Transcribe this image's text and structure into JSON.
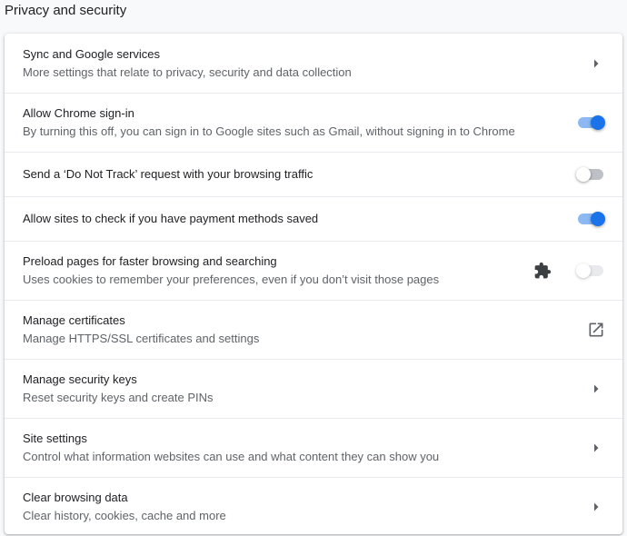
{
  "section": {
    "title": "Privacy and security"
  },
  "rows": [
    {
      "primary": "Sync and Google services",
      "secondary": "More settings that relate to privacy, security and data collection",
      "control": "chevron-right-icon"
    },
    {
      "primary": "Allow Chrome sign-in",
      "secondary": "By turning this off, you can sign in to Google sites such as Gmail, without signing in to Chrome",
      "control": "toggle",
      "checked": true
    },
    {
      "primary": "Send a ‘Do Not Track’ request with your browsing traffic",
      "control": "toggle",
      "checked": false
    },
    {
      "primary": "Allow sites to check if you have payment methods saved",
      "control": "toggle",
      "checked": true
    },
    {
      "primary": "Preload pages for faster browsing and searching",
      "secondary": "Uses cookies to remember your preferences, even if you don’t visit those pages",
      "control": "toggle",
      "checked": false,
      "disabled": true,
      "policy_icon": "extension-puzzle-icon"
    },
    {
      "primary": "Manage certificates",
      "secondary": "Manage HTTPS/SSL certificates and settings",
      "control": "open-in-new-icon"
    },
    {
      "primary": "Manage security keys",
      "secondary": "Reset security keys and create PINs",
      "control": "chevron-right-icon"
    },
    {
      "primary": "Site settings",
      "secondary": "Control what information websites can use and what content they can show you",
      "control": "chevron-right-icon"
    },
    {
      "primary": "Clear browsing data",
      "secondary": "Clear history, cookies, cache and more",
      "control": "chevron-right-icon"
    }
  ],
  "colors": {
    "accent": "#1a73e8",
    "accent_track": "#8ab4f8",
    "text_primary": "#202124",
    "text_secondary": "#5f6368",
    "page_background": "#f8f9fa",
    "card_background": "#ffffff",
    "icon_color": "#5f6368"
  }
}
